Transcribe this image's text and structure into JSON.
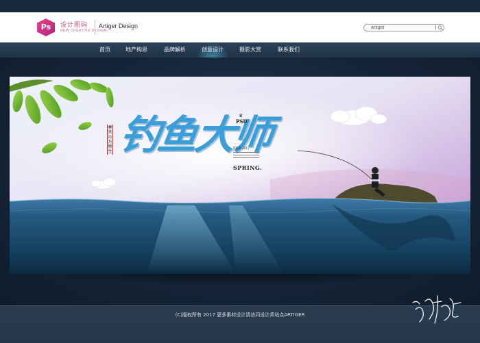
{
  "header": {
    "logo_icon_text": "Ps",
    "logo_title": "设计图码",
    "logo_subtitle": "NEW CREATIVE DESIGN",
    "brand_name": "Artiger Design",
    "search": {
      "value": "artiger"
    }
  },
  "nav": {
    "items": [
      {
        "label": "首页"
      },
      {
        "label": "地产构思"
      },
      {
        "label": "品牌解析"
      },
      {
        "label": "创意设计",
        "active": true
      },
      {
        "label": "摄影大赏"
      },
      {
        "label": "联系我们"
      }
    ]
  },
  "banner": {
    "title": "钓鱼大师",
    "vertical_tag": "春天の万物生",
    "psd": "PSD",
    "idea": "IDEA 2017",
    "spring": "SPRING."
  },
  "footer": {
    "copyright": "(C)版权所有 2017 更多素材设计请访问设计师站点ARTIGER"
  },
  "colors": {
    "page_bg": "#17283b",
    "nav_bg": "#2b4158",
    "accent_pink": "#d23a84",
    "title_blue": "#3a9fd9",
    "sea_blue": "#1d4f73"
  }
}
